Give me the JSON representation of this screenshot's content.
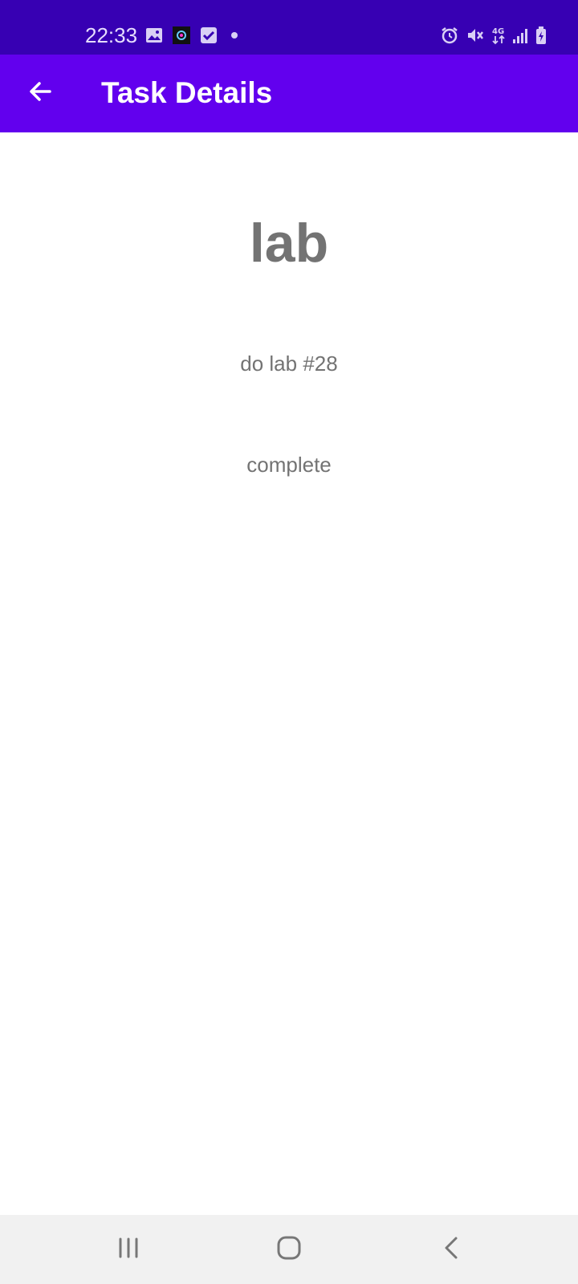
{
  "status_bar": {
    "time": "22:33",
    "left_icons": [
      "gallery-icon",
      "app-icon",
      "checkbox-icon",
      "dot-icon"
    ],
    "right_icons": [
      "alarm-icon",
      "mute-icon",
      "network-4g-icon",
      "signal-icon",
      "battery-charging-icon"
    ],
    "network_label": "4G"
  },
  "app_bar": {
    "title": "Task Details",
    "back_icon": "arrow-back-icon",
    "color": "#6200ee"
  },
  "task": {
    "title": "lab",
    "description": "do lab #28",
    "status": "complete"
  },
  "nav_bar": {
    "buttons": [
      "recent-apps-icon",
      "home-icon",
      "back-icon"
    ]
  },
  "colors": {
    "status_bar": "#3700b3",
    "app_bar": "#6200ee",
    "text": "#737373",
    "nav_bar": "#f1f1f1"
  }
}
